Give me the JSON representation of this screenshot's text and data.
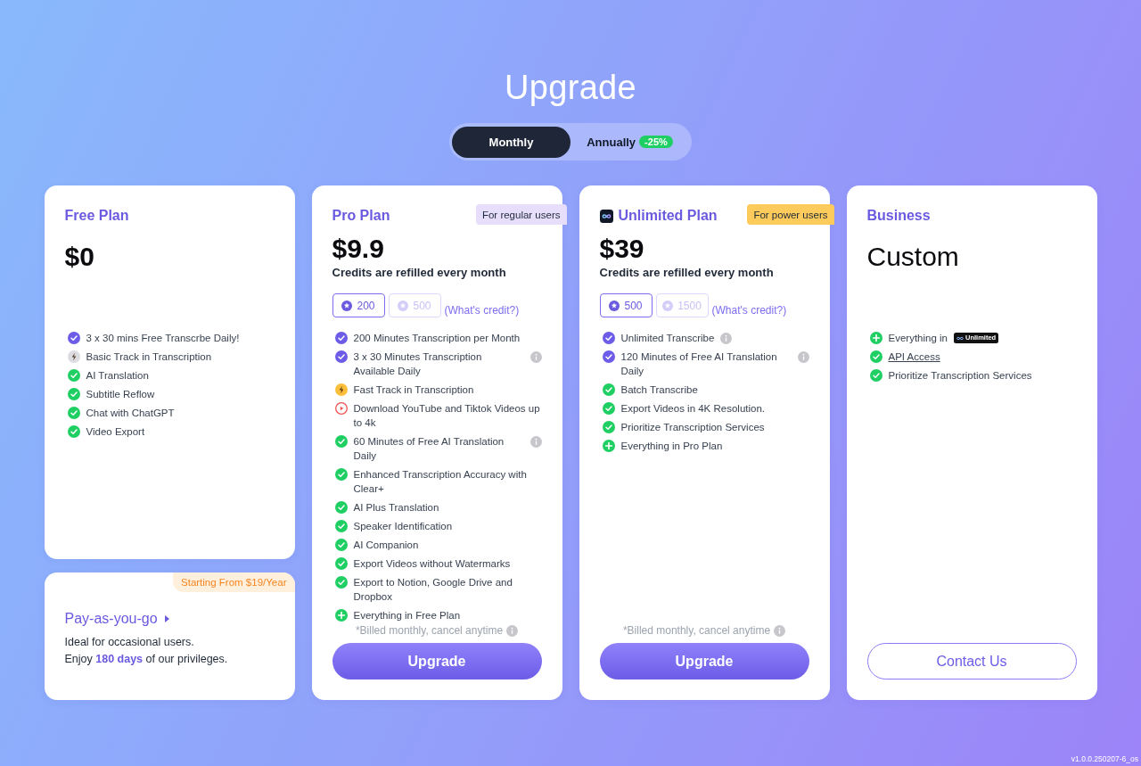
{
  "title": "Upgrade",
  "billing_toggle": [
    {
      "label": "Monthly",
      "selected": true
    },
    {
      "label": "Annually",
      "selected": false,
      "badge": "-25%"
    }
  ],
  "plans": [
    {
      "kind": "amount",
      "logo": false,
      "name": "Free Plan",
      "price": "$0",
      "features": [
        {
          "kind": "highlight",
          "text": "3 x 30 mins Free Transcrbe Daily!"
        },
        {
          "kind": "bolt",
          "text": "Basic Track in Transcription"
        },
        {
          "kind": "check",
          "text": "AI Translation"
        },
        {
          "kind": "check",
          "text": "Subtitle Reflow"
        },
        {
          "kind": "check",
          "text": "Chat with ChatGPT"
        },
        {
          "kind": "check",
          "text": "Video Export"
        }
      ]
    },
    {
      "kind": "amount",
      "logo": false,
      "name": "Pro Plan",
      "tag": {
        "text": "For regular users",
        "color": "#e7defc"
      },
      "price": "$9.9",
      "subtitle": "Credits are refilled every month",
      "credits": {
        "options": [
          {
            "amount": "200",
            "selected": true
          },
          {
            "amount": "500",
            "selected": false
          }
        ],
        "link": "(What's credit?)"
      },
      "features": [
        {
          "kind": "highlight",
          "text": "200 Minutes Transcription per Month",
          "info": false
        },
        {
          "kind": "highlight",
          "text": "3 x 30 Minutes Transcription Available Daily",
          "info": true
        },
        {
          "kind": "fast",
          "text": "Fast Track in Transcription",
          "info": false
        },
        {
          "kind": "play",
          "text": "Download YouTube and Tiktok Videos up to 4k",
          "info": false
        },
        {
          "kind": "check",
          "text": "60 Minutes of Free AI Translation Daily",
          "info": true
        },
        {
          "kind": "check",
          "text": "Enhanced Transcription Accuracy with Clear+",
          "info": false
        },
        {
          "kind": "check",
          "text": "AI Plus Translation",
          "info": false
        },
        {
          "kind": "check",
          "text": "Speaker Identification",
          "info": false
        },
        {
          "kind": "check",
          "text": "AI Companion",
          "info": false
        },
        {
          "kind": "check",
          "text": "Export Videos without Watermarks",
          "info": false
        },
        {
          "kind": "check",
          "text": "Export to Notion, Google Drive and Dropbox",
          "info": false
        },
        {
          "kind": "plus",
          "text": "Everything in Free Plan",
          "info": false
        }
      ],
      "note": "*Billed monthly, cancel anytime",
      "button": {
        "label": "Upgrade",
        "kind": "primary"
      }
    },
    {
      "kind": "amount",
      "logo": true,
      "name": "Unlimited Plan",
      "tag": {
        "text": "For power users",
        "color": "#fccb5c"
      },
      "price": "$39",
      "subtitle": "Credits are refilled every month",
      "credits": {
        "options": [
          {
            "amount": "500",
            "selected": true
          },
          {
            "amount": "1500",
            "selected": false
          }
        ],
        "link": "(What's credit?)"
      },
      "features": [
        {
          "kind": "highlight",
          "text": "Unlimited Transcribe",
          "info": true
        },
        {
          "kind": "highlight",
          "text": "120 Minutes of Free AI Translation Daily",
          "info": true
        },
        {
          "kind": "check",
          "text": "Batch Transcribe",
          "info": false
        },
        {
          "kind": "check",
          "text": "Export Videos in 4K Resolution.",
          "info": false
        },
        {
          "kind": "check",
          "text": "Prioritize Transcription Services",
          "info": false
        },
        {
          "kind": "plus",
          "text": "Everything in Pro Plan",
          "info": false
        }
      ],
      "note": "*Billed monthly, cancel anytime",
      "button": {
        "label": "Upgrade",
        "kind": "primary"
      }
    },
    {
      "kind": "custom",
      "logo": false,
      "name": "Business",
      "price": "Custom",
      "features": [
        {
          "kind": "plus",
          "text": "Everything in",
          "tag": "Unlimited",
          "link": false
        },
        {
          "kind": "check",
          "text": "API Access",
          "link": true
        },
        {
          "kind": "check",
          "text": "Prioritize Transcription Services",
          "link": false
        }
      ],
      "button": {
        "label": "Contact Us",
        "kind": "outline"
      }
    }
  ],
  "pay_as_you_go": {
    "badge": "Starting From $19/Year",
    "title": "Pay-as-you-go",
    "lines": [
      "Ideal for occasional users.",
      "Enjoy **180 days** of our privileges."
    ]
  },
  "version": "v1.0.0.250207-6_os"
}
